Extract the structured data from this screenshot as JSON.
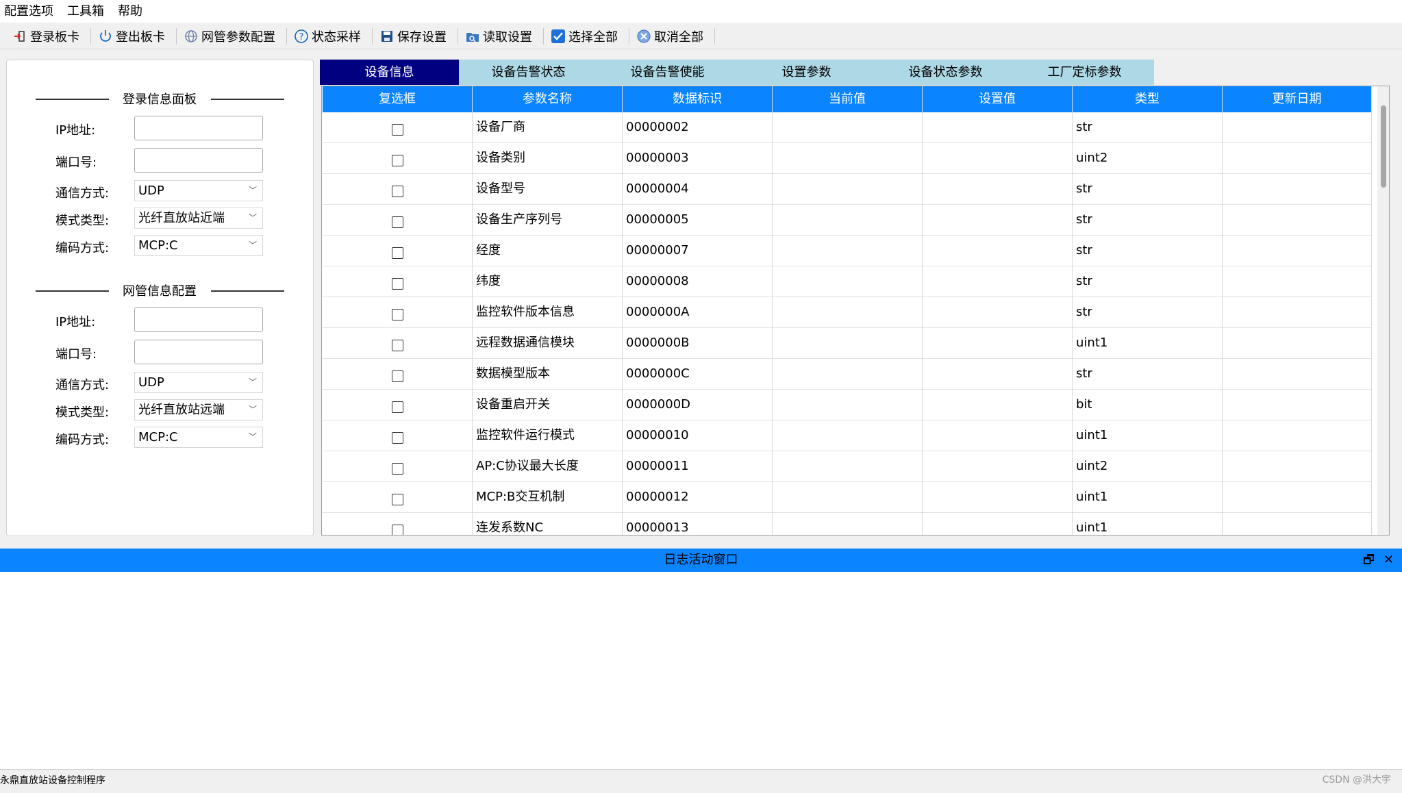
{
  "menu": [
    "配置选项",
    "工具箱",
    "帮助"
  ],
  "toolbar": [
    {
      "label": "登录板卡",
      "icon": "login-icon"
    },
    {
      "label": "登出板卡",
      "icon": "power-icon"
    },
    {
      "label": "网管参数配置",
      "icon": "network-icon"
    },
    {
      "label": "状态采样",
      "icon": "help-circle-icon"
    },
    {
      "label": "保存设置",
      "icon": "save-icon"
    },
    {
      "label": "读取设置",
      "icon": "read-icon"
    },
    {
      "label": "选择全部",
      "icon": "checkbox-checked-icon"
    },
    {
      "label": "取消全部",
      "icon": "cancel-icon"
    }
  ],
  "login_panel": {
    "title": "登录信息面板",
    "ip_label": "IP地址:",
    "ip_value": "",
    "port_label": "端口号:",
    "port_value": "",
    "comm_label": "通信方式:",
    "comm_value": "UDP",
    "mode_label": "模式类型:",
    "mode_value": "光纤直放站近端",
    "enc_label": "编码方式:",
    "enc_value": "MCP:C"
  },
  "nm_panel": {
    "title": "网管信息配置",
    "ip_label": "IP地址:",
    "ip_value": "",
    "port_label": "端口号:",
    "port_value": "",
    "comm_label": "通信方式:",
    "comm_value": "UDP",
    "mode_label": "模式类型:",
    "mode_value": "光纤直放站远端",
    "enc_label": "编码方式:",
    "enc_value": "MCP:C"
  },
  "tabs": [
    "设备信息",
    "设备告警状态",
    "设备告警使能",
    "设置参数",
    "设备状态参数",
    "工厂定标参数"
  ],
  "table": {
    "columns": [
      "复选框",
      "参数名称",
      "数据标识",
      "当前值",
      "设置值",
      "类型",
      "更新日期"
    ],
    "rows": [
      {
        "name": "设备厂商",
        "id": "00000002",
        "current": "",
        "set": "",
        "type": "str",
        "date": ""
      },
      {
        "name": "设备类别",
        "id": "00000003",
        "current": "",
        "set": "",
        "type": "uint2",
        "date": ""
      },
      {
        "name": "设备型号",
        "id": "00000004",
        "current": "",
        "set": "",
        "type": "str",
        "date": ""
      },
      {
        "name": "设备生产序列号",
        "id": "00000005",
        "current": "",
        "set": "",
        "type": "str",
        "date": ""
      },
      {
        "name": "经度",
        "id": "00000007",
        "current": "",
        "set": "",
        "type": "str",
        "date": ""
      },
      {
        "name": "纬度",
        "id": "00000008",
        "current": "",
        "set": "",
        "type": "str",
        "date": ""
      },
      {
        "name": "监控软件版本信息",
        "id": "0000000A",
        "current": "",
        "set": "",
        "type": "str",
        "date": ""
      },
      {
        "name": "远程数据通信模块",
        "id": "0000000B",
        "current": "",
        "set": "",
        "type": "uint1",
        "date": ""
      },
      {
        "name": "数据模型版本",
        "id": "0000000C",
        "current": "",
        "set": "",
        "type": "str",
        "date": ""
      },
      {
        "name": "设备重启开关",
        "id": "0000000D",
        "current": "",
        "set": "",
        "type": "bit",
        "date": ""
      },
      {
        "name": "监控软件运行模式",
        "id": "00000010",
        "current": "",
        "set": "",
        "type": "uint1",
        "date": ""
      },
      {
        "name": "AP:C协议最大长度",
        "id": "00000011",
        "current": "",
        "set": "",
        "type": "uint2",
        "date": ""
      },
      {
        "name": "MCP:B交互机制",
        "id": "00000012",
        "current": "",
        "set": "",
        "type": "uint1",
        "date": ""
      },
      {
        "name": "连发系数NC",
        "id": "00000013",
        "current": "",
        "set": "",
        "type": "uint1",
        "date": ""
      }
    ]
  },
  "log_window": {
    "title": "日志活动窗口",
    "restore": "🗗",
    "close": "✕"
  },
  "status": {
    "text": "永鼎直放站设备控制程序",
    "watermark": "CSDN @洪大宇"
  }
}
